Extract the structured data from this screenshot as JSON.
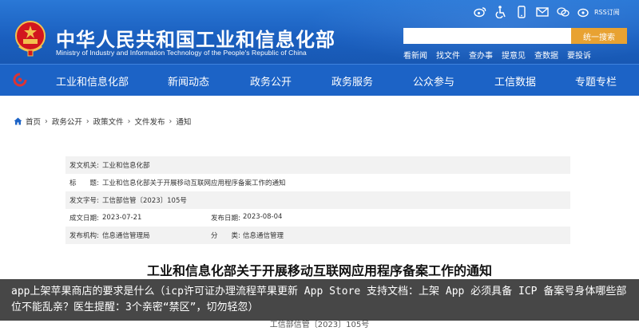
{
  "header": {
    "title": "中华人民共和国工业和信息化部",
    "subtitle": "Ministry of Industry and Information Technology of the People's Republic of China",
    "top_icons": [
      "weibo-icon",
      "accessibility-icon",
      "mobile-icon",
      "mail-icon",
      "wechat-icon",
      "weibo-eye-icon",
      "rss-icon"
    ],
    "rss_label": "RSS订阅",
    "search_placeholder": "",
    "search_button": "统一搜索",
    "quick_links": [
      "看新闻",
      "找文件",
      "查办事",
      "提意见",
      "查数据",
      "要投诉"
    ]
  },
  "nav": {
    "items": [
      "工业和信息化部",
      "新闻动态",
      "政务公开",
      "政务服务",
      "公众参与",
      "工信数据",
      "专题专栏"
    ]
  },
  "breadcrumb": [
    "首页",
    "政务公开",
    "政策文件",
    "文件发布",
    "通知"
  ],
  "info": {
    "issuer_label": "发文机关:",
    "issuer": "工业和信息化部",
    "title_label": "标　　题:",
    "title": "工业和信息化部关于开展移动互联网应用程序备案工作的通知",
    "docno_label": "发文字号:",
    "docno": "工信部信管〔2023〕105号",
    "created_label": "成文日期:",
    "created": "2023-07-21",
    "published_label": "发布日期:",
    "published": "2023-08-04",
    "org_label": "发布机构:",
    "org": "信息通信管理局",
    "category_label": "分　　类:",
    "category": "信息通信管理"
  },
  "article": {
    "title": "工业和信息化部关于开展移动互联网应用程序备案工作的通知",
    "doc_number": "工信部信管〔2023〕105号"
  },
  "caption": {
    "text": "app上架苹果商店的要求是什么（icp许可证办理流程苹果更新 App Store 支持文档：上架 App 必须具备 ICP 备案号身体哪些部位不能乱亲？医生提醒：3个亲密“禁区”，切勿轻忽）"
  },
  "colors": {
    "header_blue": "#1a5fbf",
    "nav_blue": "#1c63c6",
    "search_orange": "#e8a232"
  }
}
